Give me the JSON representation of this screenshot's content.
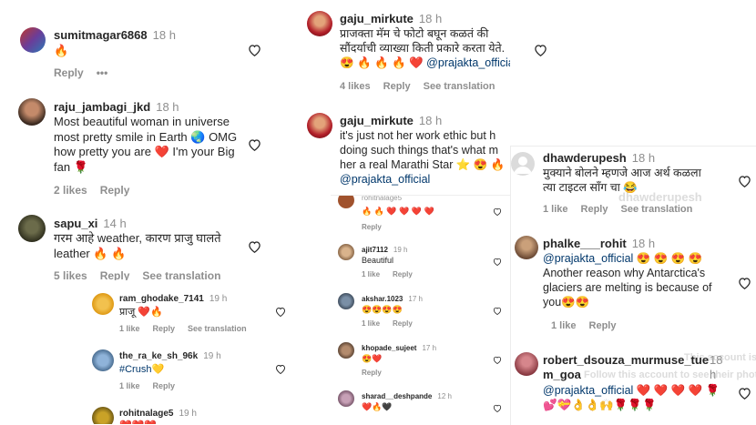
{
  "left": {
    "comments": [
      {
        "user": "sumitmagar6868",
        "time": "18 h",
        "text": "🔥",
        "actions": [
          "Reply",
          "•••"
        ]
      },
      {
        "user": "raju_jambagi_jkd",
        "time": "18 h",
        "lines": [
          "Most beautiful woman in universe",
          "most pretty smile in Earth 🌏 OMG",
          "how pretty you are ❤️ I'm your Big",
          "fan 🌹"
        ],
        "actions": [
          "2 likes",
          "Reply"
        ]
      },
      {
        "user": "sapu_xi",
        "time": "14 h",
        "lines": [
          "गरम आहे weather, कारण प्राजु घालते",
          "leather 🔥 🔥"
        ],
        "actions": [
          "5 likes",
          "Reply",
          "See translation"
        ]
      }
    ],
    "replies": [
      {
        "user": "ram_ghodake_7141",
        "time": "19 h",
        "text": "प्राजू ❤️🔥",
        "actions": [
          "1 like",
          "Reply",
          "See translation"
        ]
      },
      {
        "user": "the_ra_ke_sh_96k",
        "time": "19 h",
        "text": "#Crush💛",
        "actions": [
          "1 like",
          "Reply"
        ]
      },
      {
        "user": "rohitnalage5",
        "time": "19 h",
        "text": "❤️❤️❤️"
      }
    ]
  },
  "middle": {
    "comments": [
      {
        "user": "gaju_mirkute",
        "time": "18 h",
        "lines": [
          "प्राजक्ता मॅम चे फोटो बघून कळतं की",
          "सौंदर्याची व्याख्या किती प्रकारे करता येते.",
          "😍 🔥 🔥 🔥 ❤️ @prajakta_official"
        ],
        "actions": [
          "4 likes",
          "Reply",
          "See translation"
        ]
      },
      {
        "user": "gaju_mirkute",
        "time": "18 h",
        "lines": [
          "it's just not her work ethic but h",
          "doing such things that's what m",
          "her a real Marathi Star ⭐ 😍 🔥",
          "@prajakta_official"
        ]
      }
    ],
    "small": [
      {
        "user": "rohitnalage5",
        "text": "🔥 🔥 ❤️ ❤️ ❤️ ❤️",
        "actions": [
          "Reply"
        ]
      },
      {
        "user": "ajit7112",
        "time": "19 h",
        "text": "Beautiful",
        "actions": [
          "1 like",
          "Reply"
        ]
      },
      {
        "user": "akshar.1023",
        "time": "17 h",
        "text": "😍😍😍😍",
        "actions": [
          "1 like",
          "Reply"
        ]
      },
      {
        "user": "khopade_sujeet",
        "time": "17 h",
        "text": "😍❤️",
        "actions": [
          "Reply"
        ]
      },
      {
        "user": "sharad__deshpande",
        "time": "12 h",
        "text": "❤️🔥🖤"
      }
    ]
  },
  "right": {
    "comments": [
      {
        "user": "dhawderupesh",
        "time": "18 h",
        "lines": [
          "मुक्याने बोलने म्हणजे आज अर्थ कळला",
          "त्या टाइटल सॉंग चा 😂"
        ],
        "actions": [
          "1 like",
          "Reply",
          "See translation"
        ]
      },
      {
        "user": "phalke___rohit",
        "time": "18 h",
        "lines": [
          "@prajakta_official 😍 😍 😍 😍",
          "Another reason why Antarctica's",
          "glaciers are melting is because of",
          "you😍😍"
        ],
        "actions": [
          "1 like",
          "Reply"
        ]
      },
      {
        "user": "robert_dsouza_murmuse_tue",
        "user2": "m_goa",
        "time": "18",
        "time2": "h",
        "lines": [
          "@prajakta_official ❤️ ❤️ ❤️ ❤️ 🌹",
          "💕💝👌👌🙌🌹🌹🌹"
        ]
      }
    ],
    "ghost": {
      "name": "dhawderupesh",
      "private": "This account is private",
      "follow": "Follow this account to see their photos"
    }
  }
}
